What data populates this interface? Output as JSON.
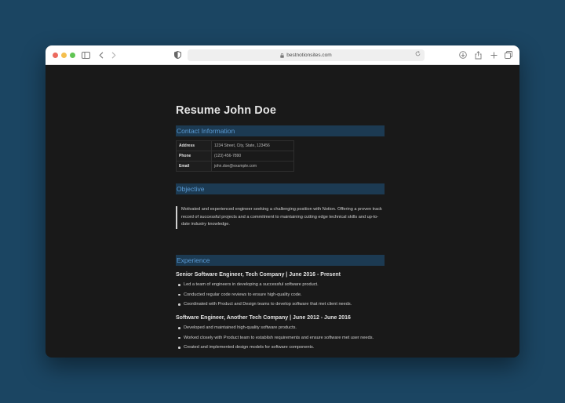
{
  "browser": {
    "url": "bestnotionsites.com",
    "colors": {
      "close": "#ec6a5e",
      "minimize": "#f4bf4f",
      "zoom": "#61c554"
    },
    "icons": [
      "sidebar-icon",
      "back-icon",
      "forward-icon",
      "privacy-icon",
      "lock-icon",
      "reload-icon",
      "download-icon",
      "share-icon",
      "new-tab-icon",
      "tabs-overview-icon"
    ]
  },
  "resume": {
    "title": "Resume John Doe",
    "contact": {
      "heading": "Contact Information",
      "rows": [
        {
          "label": "Address",
          "value": "1234 Street, City, State, 123456"
        },
        {
          "label": "Phone",
          "value": "(123) 456-7890"
        },
        {
          "label": "Email",
          "value": "john.doe@example.com"
        }
      ]
    },
    "objective": {
      "heading": "Objective",
      "text": "Motivated and experienced engineer seeking a challenging position with Notion. Offering a proven track record of successful projects and a commitment to maintaining cutting edge technical skills and up-to-date industry knowledge."
    },
    "experience": {
      "heading": "Experience",
      "jobs": [
        {
          "title": "Senior Software Engineer, Tech Company | June 2016 - Present",
          "duties": [
            "Led a team of engineers in developing a successful software product.",
            "Conducted regular code reviews to ensure high-quality code.",
            "Coordinated with Product and Design teams to develop software that met client needs."
          ]
        },
        {
          "title": "Software Engineer, Another Tech Company | June 2012 - June 2016",
          "duties": [
            "Developed and maintained high-quality software products.",
            "Worked closely with Product team to establish requirements and ensure software met user needs.",
            "Created and implemented design models for software components."
          ]
        }
      ]
    },
    "colors": {
      "section_bg": "#1c3a52",
      "section_text": "#5a9bd5",
      "page_bg": "#191919"
    }
  }
}
